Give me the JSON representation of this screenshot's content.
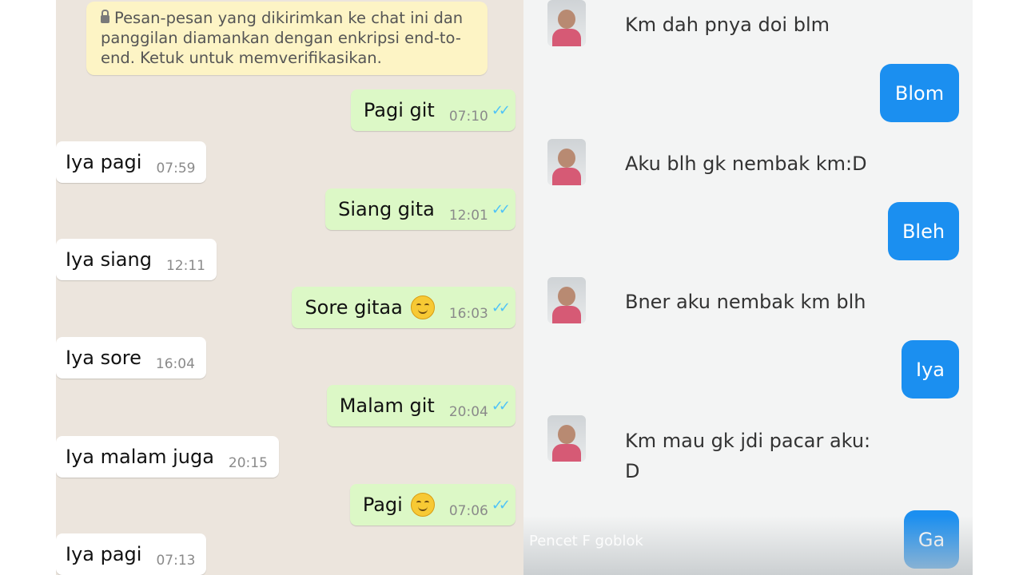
{
  "left_chat": {
    "encryption_notice": "Pesan-pesan yang dikirimkan ke chat ini dan panggilan diamankan dengan enkripsi end-to-end. Ketuk untuk memverifikasikan.",
    "messages": [
      {
        "text": "Pagi git",
        "time": "07:10",
        "dir": "out"
      },
      {
        "text": "Iya pagi",
        "time": "07:59",
        "dir": "in"
      },
      {
        "text": "Siang gita",
        "time": "12:01",
        "dir": "out"
      },
      {
        "text": "Iya siang",
        "time": "12:11",
        "dir": "in"
      },
      {
        "text": "Sore gitaa",
        "time": "16:03",
        "dir": "out",
        "emoji": "smile"
      },
      {
        "text": "Iya sore",
        "time": "16:04",
        "dir": "in"
      },
      {
        "text": "Malam git",
        "time": "20:04",
        "dir": "out"
      },
      {
        "text": "Iya malam juga",
        "time": "20:15",
        "dir": "in"
      },
      {
        "text": "Pagi",
        "time": "07:06",
        "dir": "out",
        "emoji": "smile"
      },
      {
        "text": "Iya pagi",
        "time": "07:13",
        "dir": "in"
      }
    ],
    "tick_color": "#4fc3f7",
    "outgoing_color": "#dcf8c6"
  },
  "right_chat": {
    "received": [
      {
        "text": "Km dah pnya doi blm"
      },
      {
        "text": "Aku blh gk nembak km:D"
      },
      {
        "text": "Bner aku nembak km blh"
      },
      {
        "text": "Km mau gk jdi pacar aku: D"
      }
    ],
    "replies": [
      "Blom",
      "Bleh",
      "Iya",
      "Ga"
    ],
    "reply_color": "#1b8ff0",
    "caption": "Pencet F goblok"
  }
}
